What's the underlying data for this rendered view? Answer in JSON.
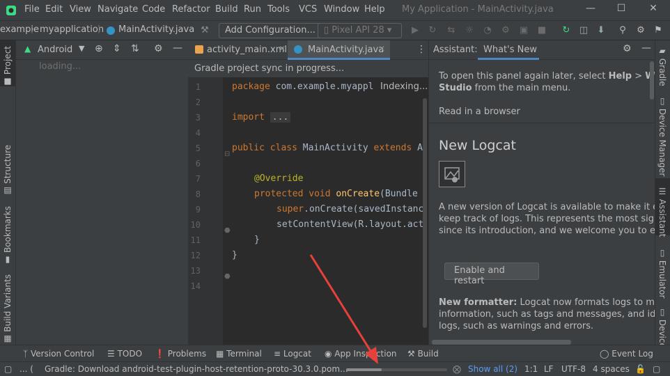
{
  "menu": {
    "items": [
      "File",
      "Edit",
      "View",
      "Navigate",
      "Code",
      "Refactor",
      "Build",
      "Run",
      "Tools",
      "VCS",
      "Window",
      "Help"
    ],
    "window_title": "My Application - MainActivity.java"
  },
  "navbar": {
    "breadcrumbs": [
      "example",
      "myapplication",
      "MainActivity.java"
    ],
    "add_config": "Add Configuration...",
    "device": "Pixel API 28"
  },
  "left_stripe": {
    "project": "Project",
    "structure": "Structure",
    "bookmarks": "Bookmarks",
    "build_variants": "Build Variants"
  },
  "project_panel": {
    "view": "Android",
    "loading": "loading..."
  },
  "editor": {
    "tabs": [
      {
        "label": "activity_main.xml"
      },
      {
        "label": "MainActivity.java"
      }
    ],
    "sync_banner": "Gradle project sync in progress...",
    "indexing": "Indexing...",
    "line_numbers": [
      "1",
      "2",
      "3",
      "4",
      "5",
      "6",
      "7",
      "8",
      "9",
      "10",
      "11",
      "12",
      "13",
      "14"
    ]
  },
  "assistant": {
    "panel_title": "Assistant:",
    "tab": "What's New",
    "intro_a": "To open this panel again later, select ",
    "intro_help": "Help",
    "intro_gt": " > ",
    "intro_whats": "What's",
    "intro_studio": "Studio",
    "intro_b": " from the main menu.",
    "read_browser": "Read in a browser",
    "heading": "New Logcat",
    "desc1": "A new version of Logcat is available to make it easier",
    "desc2": "keep track of logs. This represents the most significa",
    "desc3": "since its introduction, and we welcome you to enable",
    "enable_button": "Enable and restart",
    "formatter_bold": "New formatter:",
    "formatter1": " Logcat now formats logs to make it",
    "formatter2": "information, such as tags and messages, and identify",
    "formatter3": "logs, such as warnings and errors."
  },
  "right_stripe": {
    "gradle": "Gradle",
    "device_manager": "Device Manager",
    "assistant": "Assistant",
    "emulator": "Emulator",
    "device": "Device"
  },
  "bottom_tools": {
    "version_control": "Version Control",
    "todo": "TODO",
    "problems": "Problems",
    "terminal": "Terminal",
    "logcat": "Logcat",
    "app_inspection": "App Inspection",
    "build": "Build",
    "event_log": "Event Log"
  },
  "status": {
    "ellipsis": "... (",
    "message": "Gradle: Download android-test-plugin-host-retention-proto-30.3.0.pom...",
    "show_all": "Show all (2)",
    "position": "1:1",
    "line_sep": "LF",
    "encoding": "UTF-8",
    "indent": "4 spaces"
  },
  "colors": {
    "accent": "#589df6",
    "arrow": "#e8403a",
    "keyword": "#cc7832"
  }
}
